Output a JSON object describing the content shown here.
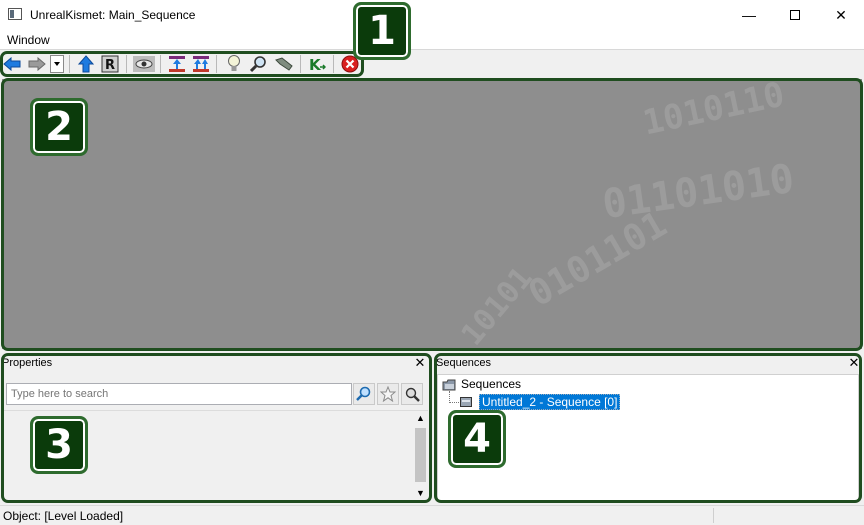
{
  "window": {
    "title": "UnrealKismet: Main_Sequence",
    "minimize_glyph": "—",
    "maximize_glyph": "☐",
    "close_glyph": "✕"
  },
  "menu": {
    "items": [
      "Window"
    ]
  },
  "toolbar": {
    "icons": [
      "back-arrow-icon",
      "forward-arrow-icon",
      "history-dropdown-icon",
      "parent-sequence-icon",
      "rename-icon",
      "show-hidden-icon",
      "zoom-to-fit-icon",
      "zoom-to-selected-icon",
      "lightbulb-icon",
      "search-icon",
      "wrench-icon",
      "kismet-k-icon",
      "stop-icon"
    ]
  },
  "callouts": {
    "one": "1",
    "two": "2",
    "three": "3",
    "four": "4"
  },
  "properties": {
    "title": "Properties",
    "search_placeholder": "Type here to search"
  },
  "sequences": {
    "title": "Sequences",
    "root_label": "Sequences",
    "child_label": "Untitled_2 - Sequence [0]"
  },
  "status": {
    "text": "Object: [Level Loaded]"
  },
  "colors": {
    "callout_border": "#1f4d1f",
    "badge_fill": "#0b3b0b",
    "selection": "#0078d7",
    "canvas": "#8e8e8e"
  }
}
